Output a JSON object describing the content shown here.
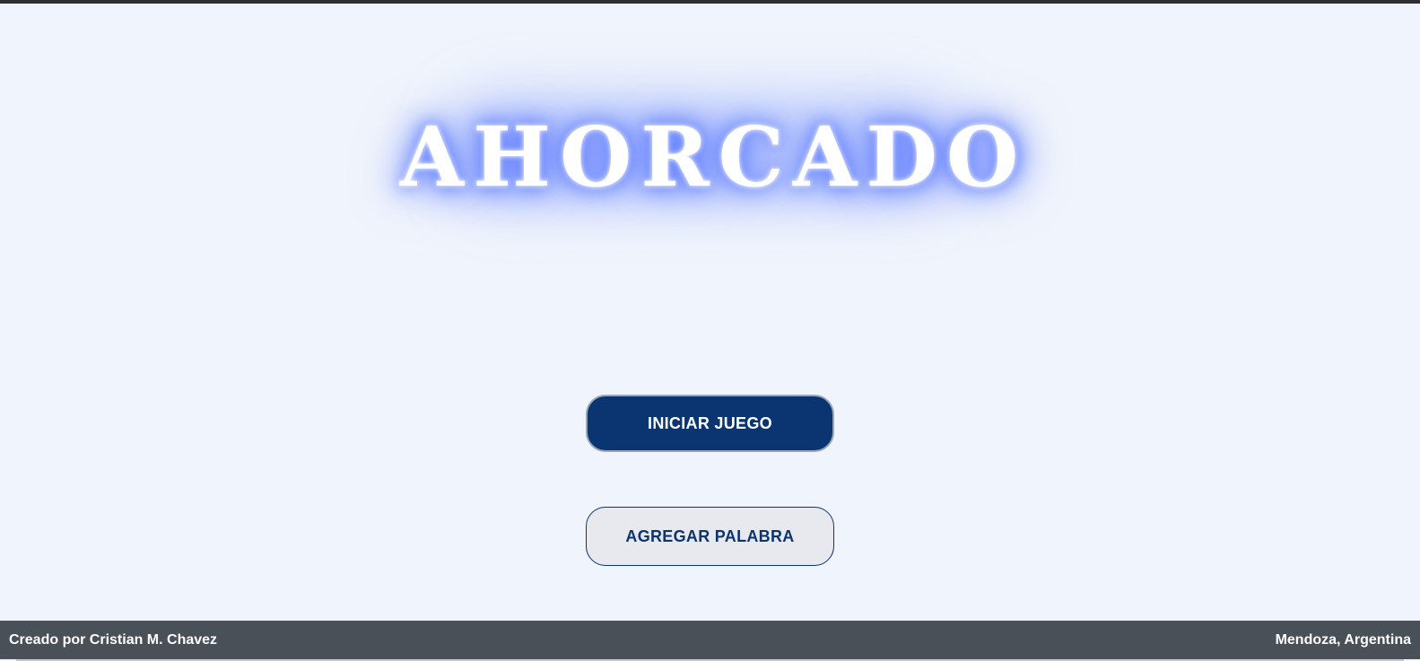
{
  "app": {
    "title": "AHORCADO"
  },
  "actions": {
    "start_label": "INICIAR JUEGO",
    "add_word_label": "AGREGAR PALABRA"
  },
  "footer": {
    "credit": "Creado por Cristian M. Chavez",
    "location": "Mendoza, Argentina"
  },
  "colors": {
    "background": "#f0f4fc",
    "primary": "#0a3570",
    "glow": "#5b78ff",
    "footer_bg": "#4a5058"
  }
}
